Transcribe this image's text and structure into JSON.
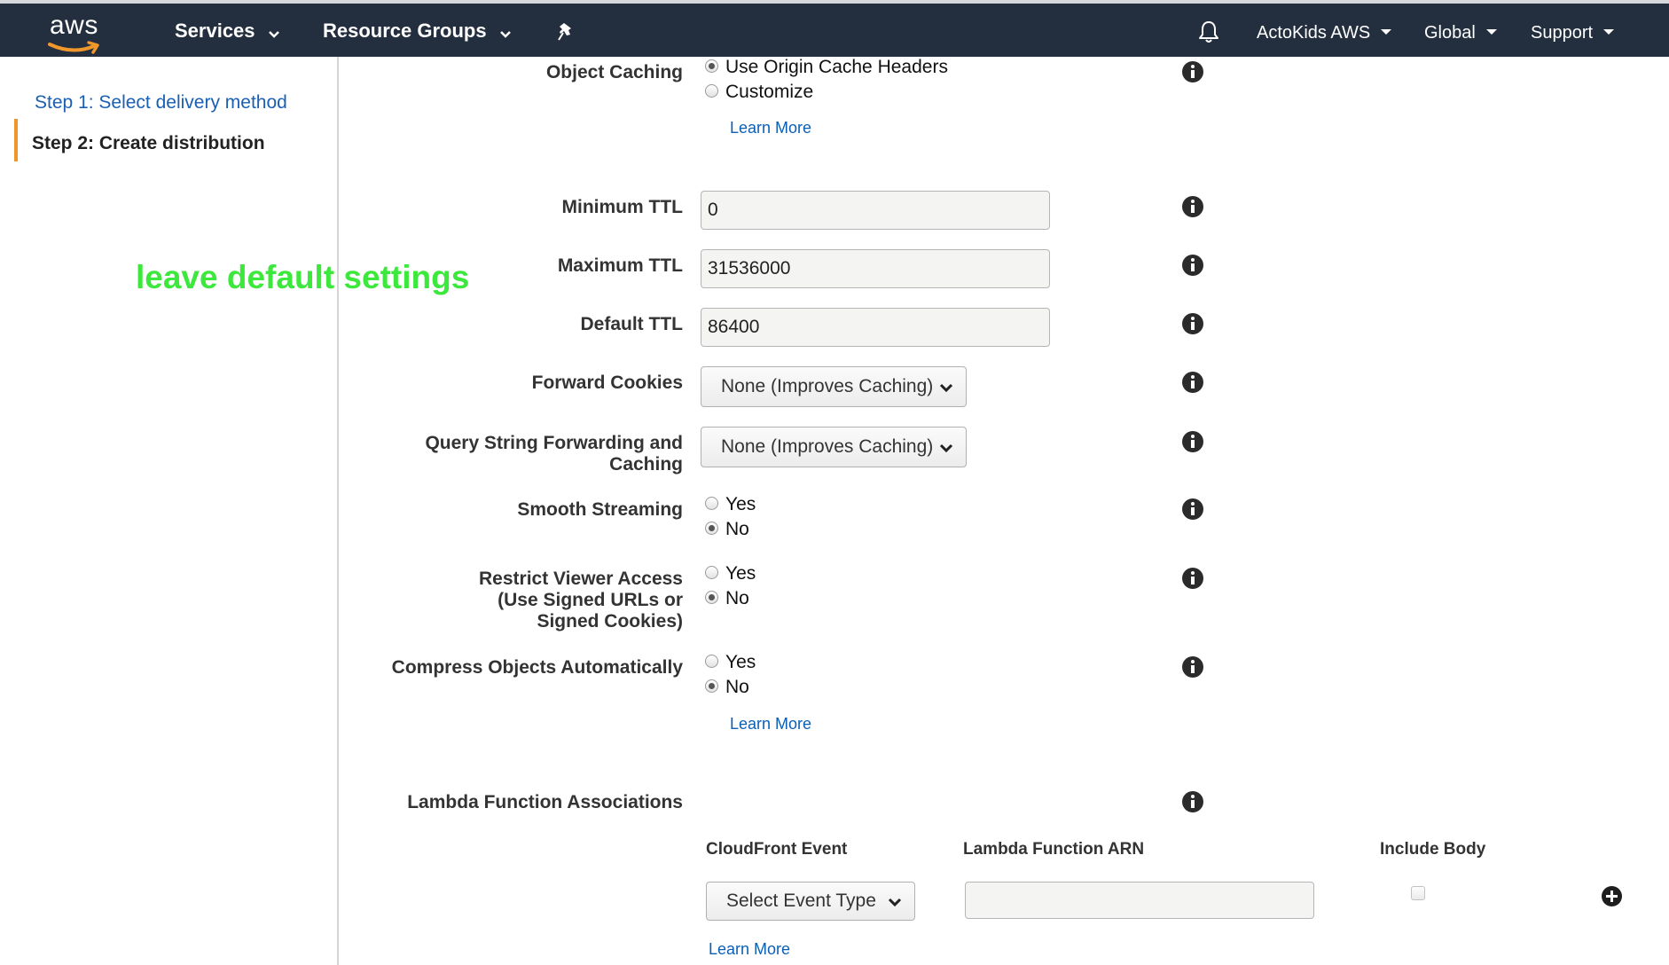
{
  "topbar": {
    "logo_text": "aws",
    "services": "Services",
    "resource_groups": "Resource Groups",
    "account": "ActoKids AWS",
    "region": "Global",
    "support": "Support"
  },
  "sidebar": {
    "steps": [
      {
        "label": "Step 1: Select delivery method",
        "state": "link"
      },
      {
        "label": "Step 2: Create distribution",
        "state": "current"
      }
    ]
  },
  "annotation": {
    "text": "leave default settings",
    "color": "#3de83d"
  },
  "form": {
    "object_caching": {
      "label": "Object Caching",
      "options": [
        "Use Origin Cache Headers",
        "Customize"
      ],
      "selected": "Use Origin Cache Headers",
      "learn_more": "Learn More"
    },
    "minimum_ttl": {
      "label": "Minimum TTL",
      "value": "0"
    },
    "maximum_ttl": {
      "label": "Maximum TTL",
      "value": "31536000"
    },
    "default_ttl": {
      "label": "Default TTL",
      "value": "86400"
    },
    "forward_cookies": {
      "label": "Forward Cookies",
      "value": "None (Improves Caching)"
    },
    "query_string": {
      "label_line1": "Query String Forwarding and",
      "label_line2": "Caching",
      "value": "None (Improves Caching)"
    },
    "smooth_streaming": {
      "label": "Smooth Streaming",
      "options": [
        "Yes",
        "No"
      ],
      "selected": "No"
    },
    "restrict_viewer": {
      "label_line1": "Restrict Viewer Access",
      "label_line2": "(Use Signed URLs or",
      "label_line3": "Signed Cookies)",
      "options": [
        "Yes",
        "No"
      ],
      "selected": "No"
    },
    "compress": {
      "label": "Compress Objects Automatically",
      "options": [
        "Yes",
        "No"
      ],
      "selected": "No",
      "learn_more": "Learn More"
    },
    "lambda": {
      "label": "Lambda Function Associations",
      "columns": [
        "CloudFront Event",
        "Lambda Function ARN",
        "Include Body"
      ],
      "event_select": "Select Event Type",
      "arn_value": "",
      "learn_more": "Learn More"
    }
  },
  "colors": {
    "topbar": "#232f3e",
    "link": "#0b5fb4",
    "accent": "#f0972b"
  }
}
